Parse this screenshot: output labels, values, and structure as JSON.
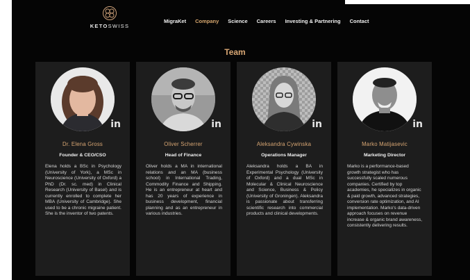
{
  "header": {
    "logo_text_bold": "KETO",
    "logo_text_light": "SWISS",
    "nav": [
      {
        "label": "MigraKet",
        "active": false
      },
      {
        "label": "Company",
        "active": true
      },
      {
        "label": "Science",
        "active": false
      },
      {
        "label": "Careers",
        "active": false
      },
      {
        "label": "Investing & Partnering",
        "active": false
      },
      {
        "label": "Contact",
        "active": false
      }
    ]
  },
  "section_title": "Team",
  "colors": {
    "accent": "#d9a774",
    "card_bg": "#1d1d1d",
    "page_bg": "#050505"
  },
  "team": [
    {
      "name": "Dr. Elena Gross",
      "role": "Founder & CEO/CSO",
      "linkedin": "in",
      "bio": "Elena holds a BSc in Psychology (University of York), a MSc in Neuroscience (University of Oxford) a PhD (Dr. sc. med) in Clinical Research (University of Basel) and is currently enrolled to complete her MBA (University of Cambridge). She used to be a chronic migraine patient. She is the inventor of two patents."
    },
    {
      "name": "Oliver Scherrer",
      "role": "Head of Finance",
      "linkedin": "in",
      "bio": "Oliver holds a MA in international relations and an MA (business school) in International Trading, Commodity Finance and Shipping. He is an entrepreneur at heart and has 20 years of experience in business development, financial planning and as an entrepreneur in various industries."
    },
    {
      "name": "Aleksandra Cywinska",
      "role": "Operations Manager",
      "linkedin": "in",
      "bio": "Aleksandra holds a BA in Experimental Psychology (University of Oxford) and a dual MSc in Molecular & Clinical Neuroscience and Science, Business & Policy (University of Groningen). Aleksandra is passionate about transferring scientific research into commercial products and clinical developments."
    },
    {
      "name": "Marko Matijasevic",
      "role": "Marketing Director",
      "linkedin": "in",
      "bio": "Marko is a performance-based growth strategist who has successfully scaled numerous companies. Certified by top academies, he specializes in organic & paid growth, advanced strategies, conversion rate optimization, and AI implementation. Marko's data-driven approach focuses on revenue increase & organic brand awareness, consistently delivering results."
    }
  ]
}
